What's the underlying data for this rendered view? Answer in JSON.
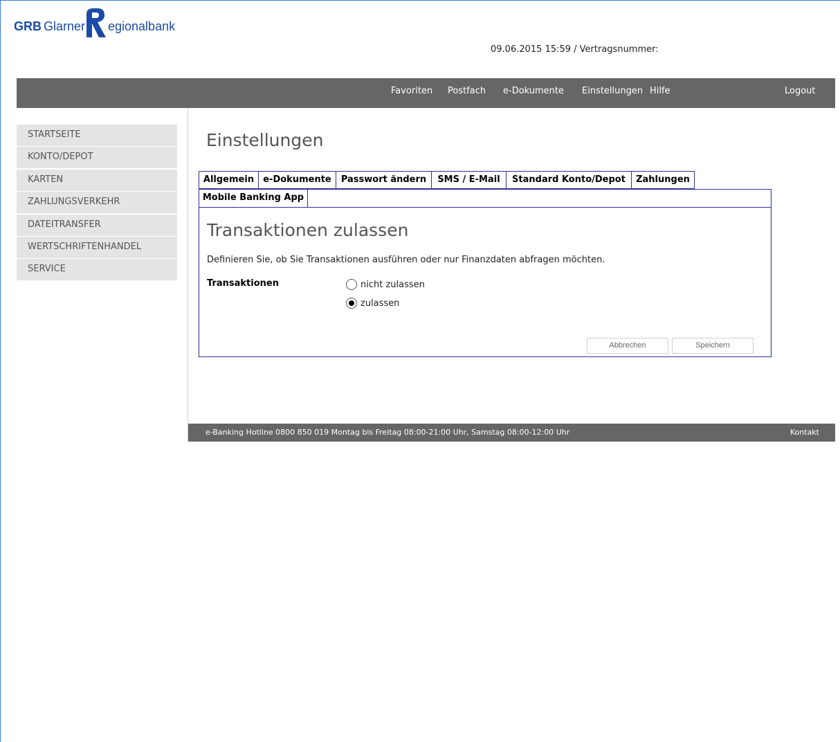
{
  "header": {
    "logo": {
      "prefix": "GRB",
      "word1": "Glarner",
      "r_letter": "R",
      "word2_rest": "egionalbank"
    },
    "contract_line": "09.06.2015 15:59 / Vertragsnummer:"
  },
  "topnav": {
    "items": [
      "Favoriten",
      "Postfach",
      "e-Dokumente",
      "Einstellungen",
      "Hilfe"
    ],
    "logout": "Logout"
  },
  "sidebar": {
    "items": [
      "STARTSEITE",
      "KONTO/DEPOT",
      "KARTEN",
      "ZAHLUNGSVERKEHR",
      "DATEITRANSFER",
      "WERTSCHRIFTENHANDEL",
      "SERVICE"
    ]
  },
  "main": {
    "title": "Einstellungen",
    "tabs_row1": [
      "Allgemein",
      "e-Dokumente",
      "Passwort ändern",
      "SMS / E-Mail",
      "Standard Konto/Depot",
      "Zahlungen"
    ],
    "tabs_row2": [
      "Mobile Banking App"
    ],
    "section_title": "Transaktionen zulassen",
    "description": "Definieren Sie, ob Sie Transaktionen ausführen oder nur Finanzdaten abfragen möchten.",
    "field_label": "Transaktionen",
    "radio_options": [
      {
        "label": "nicht zulassen",
        "checked": false
      },
      {
        "label": "zulassen",
        "checked": true
      }
    ],
    "buttons": {
      "cancel": "Abbrechen",
      "save": "Speichern"
    }
  },
  "footer": {
    "hotline": "e-Banking Hotline 0800 850 019 Montag bis Freitag 08:00-21:00 Uhr, Samstag 08:00-12:00 Uhr",
    "contact": "Kontakt"
  },
  "colors": {
    "brand_blue": "#1b4ba8",
    "nav_gray": "#666666",
    "tab_border": "#2e3192",
    "sidebar_bg": "#e4e4e4"
  }
}
